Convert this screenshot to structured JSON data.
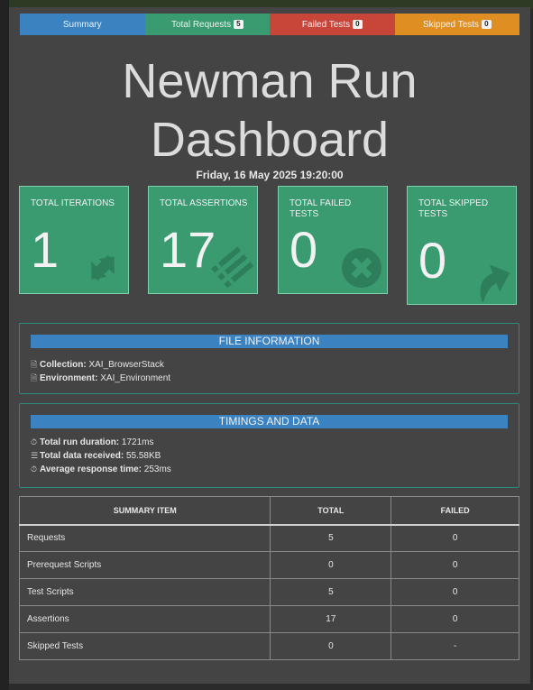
{
  "nav": {
    "summary": "Summary",
    "requests": "Total Requests",
    "requests_count": "5",
    "failed": "Failed Tests",
    "failed_count": "0",
    "skipped": "Skipped Tests",
    "skipped_count": "0"
  },
  "header": {
    "title_line1": "Newman Run",
    "title_line2": "Dashboard",
    "date": "Friday, 16 May 2025 19:20:00"
  },
  "cards": [
    {
      "label": "TOTAL ITERATIONS",
      "value": "1",
      "icon": "refresh-icon"
    },
    {
      "label": "TOTAL ASSERTIONS",
      "value": "17",
      "icon": "list-icon"
    },
    {
      "label": "TOTAL FAILED TESTS",
      "value": "0",
      "icon": "close-circle-icon"
    },
    {
      "label": "TOTAL SKIPPED TESTS",
      "value": "0",
      "icon": "share-arrow-icon"
    }
  ],
  "file_info": {
    "heading": "FILE INFORMATION",
    "collection_label": "Collection:",
    "collection_value": "XAI_BrowserStack",
    "environment_label": "Environment:",
    "environment_value": "XAI_Environment"
  },
  "timings": {
    "heading": "TIMINGS AND DATA",
    "duration_label": "Total run duration:",
    "duration_value": "1721ms",
    "data_label": "Total data received:",
    "data_value": "55.58KB",
    "avg_label": "Average response time:",
    "avg_value": "253ms"
  },
  "table": {
    "headers": [
      "SUMMARY ITEM",
      "TOTAL",
      "FAILED"
    ],
    "rows": [
      [
        "Requests",
        "5",
        "0"
      ],
      [
        "Prerequest Scripts",
        "0",
        "0"
      ],
      [
        "Test Scripts",
        "5",
        "0"
      ],
      [
        "Assertions",
        "17",
        "0"
      ],
      [
        "Skipped Tests",
        "0",
        "-"
      ]
    ]
  },
  "colors": {
    "summary": "#3b82c0",
    "requests": "#3a9a70",
    "failed": "#c8453a",
    "skipped": "#df8f21",
    "card": "#3a9a70"
  }
}
